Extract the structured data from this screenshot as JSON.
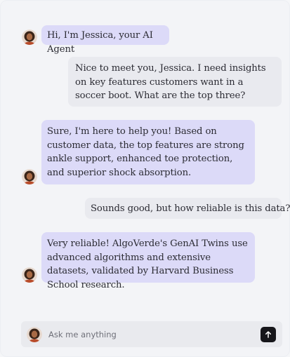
{
  "colors": {
    "agent_bubble": "#dcdaf8",
    "user_bubble": "#e9eaef",
    "background": "#f3f4f7",
    "send_button": "#16161a"
  },
  "messages": [
    {
      "sender": "agent",
      "text": "Hi, I'm Jessica, your AI Agent"
    },
    {
      "sender": "user",
      "text": "Nice to meet you, Jessica. I need insights on key features customers want in a soccer boot. What are the top three?"
    },
    {
      "sender": "agent",
      "text": "Sure, I'm here to help you! Based on customer data, the top features are strong ankle support, enhanced toe protection, and superior shock absorption."
    },
    {
      "sender": "user",
      "text": "Sounds good, but how reliable is this data?"
    },
    {
      "sender": "agent",
      "text": "Very reliable! AlgoVerde's GenAI Twins use advanced algorithms and extensive datasets, validated by Harvard Business School research."
    }
  ],
  "input": {
    "placeholder": "Ask me anything",
    "send_icon": "arrow-up-icon",
    "avatar_icon": "agent-avatar-icon"
  }
}
